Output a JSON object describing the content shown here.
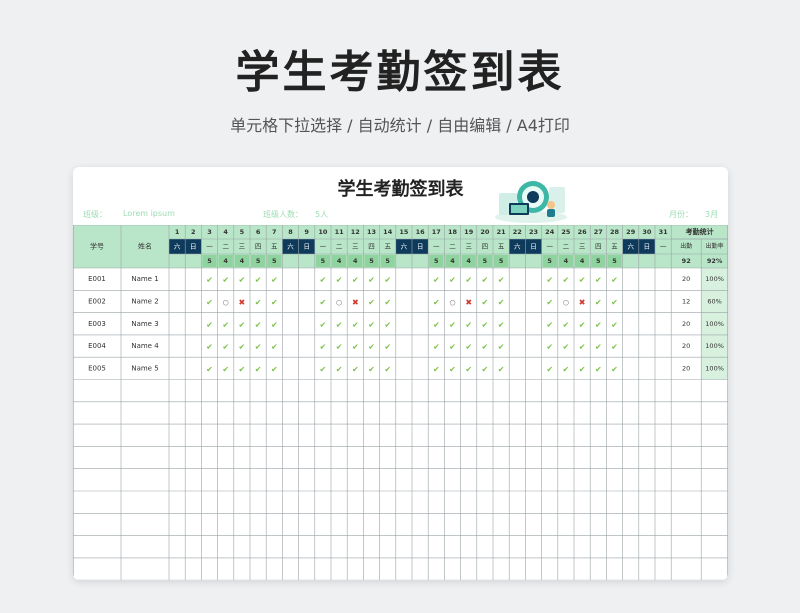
{
  "page": {
    "title": "学生考勤签到表",
    "subtitle": "单元格下拉选择 / 自动统计 / 自由编辑 / A4打印"
  },
  "sheet": {
    "title": "学生考勤签到表",
    "class_label": "班级：",
    "class_value": "Lorem ipsum",
    "count_label": "班级人数：",
    "count_value": "5人",
    "month_label": "月份：",
    "month_value": "3月"
  },
  "headers": {
    "id": "学号",
    "name": "姓名",
    "stats": "考勤统计",
    "present": "出勤",
    "rate": "出勤率"
  },
  "days": [
    "1",
    "2",
    "3",
    "4",
    "5",
    "6",
    "7",
    "8",
    "9",
    "10",
    "11",
    "12",
    "13",
    "14",
    "15",
    "16",
    "17",
    "18",
    "19",
    "20",
    "21",
    "22",
    "23",
    "24",
    "25",
    "26",
    "27",
    "28",
    "29",
    "30",
    "31"
  ],
  "weekdays": [
    "六",
    "日",
    "一",
    "二",
    "三",
    "四",
    "五",
    "六",
    "日",
    "一",
    "二",
    "三",
    "四",
    "五",
    "六",
    "日",
    "一",
    "二",
    "三",
    "四",
    "五",
    "六",
    "日",
    "一",
    "二",
    "三",
    "四",
    "五",
    "六",
    "日",
    "一"
  ],
  "daily_totals": [
    "",
    "",
    "5",
    "4",
    "4",
    "5",
    "5",
    "",
    "",
    "5",
    "4",
    "4",
    "5",
    "5",
    "",
    "",
    "5",
    "4",
    "4",
    "5",
    "5",
    "",
    "",
    "5",
    "4",
    "4",
    "5",
    "5",
    "",
    "",
    ""
  ],
  "summary": {
    "present_total": "92",
    "rate_total": "92%"
  },
  "marks": {
    "present": "✔",
    "leave": "○",
    "absent": "✖"
  },
  "students": [
    {
      "id": "E001",
      "name": "Name 1",
      "present": "20",
      "rate": "100%",
      "marks": [
        "",
        "",
        "p",
        "p",
        "p",
        "p",
        "p",
        "",
        "",
        "p",
        "p",
        "p",
        "p",
        "p",
        "",
        "",
        "p",
        "p",
        "p",
        "p",
        "p",
        "",
        "",
        "p",
        "p",
        "p",
        "p",
        "p",
        "",
        "",
        ""
      ]
    },
    {
      "id": "E002",
      "name": "Name 2",
      "present": "12",
      "rate": "60%",
      "marks": [
        "",
        "",
        "p",
        "o",
        "x",
        "p",
        "p",
        "",
        "",
        "p",
        "o",
        "x",
        "p",
        "p",
        "",
        "",
        "p",
        "o",
        "x",
        "p",
        "p",
        "",
        "",
        "p",
        "o",
        "x",
        "p",
        "p",
        "",
        "",
        ""
      ]
    },
    {
      "id": "E003",
      "name": "Name 3",
      "present": "20",
      "rate": "100%",
      "marks": [
        "",
        "",
        "p",
        "p",
        "p",
        "p",
        "p",
        "",
        "",
        "p",
        "p",
        "p",
        "p",
        "p",
        "",
        "",
        "p",
        "p",
        "p",
        "p",
        "p",
        "",
        "",
        "p",
        "p",
        "p",
        "p",
        "p",
        "",
        "",
        ""
      ]
    },
    {
      "id": "E004",
      "name": "Name 4",
      "present": "20",
      "rate": "100%",
      "marks": [
        "",
        "",
        "p",
        "p",
        "p",
        "p",
        "p",
        "",
        "",
        "p",
        "p",
        "p",
        "p",
        "p",
        "",
        "",
        "p",
        "p",
        "p",
        "p",
        "p",
        "",
        "",
        "p",
        "p",
        "p",
        "p",
        "p",
        "",
        "",
        ""
      ]
    },
    {
      "id": "E005",
      "name": "Name 5",
      "present": "20",
      "rate": "100%",
      "marks": [
        "",
        "",
        "p",
        "p",
        "p",
        "p",
        "p",
        "",
        "",
        "p",
        "p",
        "p",
        "p",
        "p",
        "",
        "",
        "p",
        "p",
        "p",
        "p",
        "p",
        "",
        "",
        "p",
        "p",
        "p",
        "p",
        "p",
        "",
        "",
        ""
      ]
    }
  ],
  "empty_rows": 9,
  "colors": {
    "header_green": "#b9e6c8",
    "weekend_navy": "#0e3a5c",
    "total_green": "#8fd39f",
    "check_green": "#7cc24a",
    "absent_red": "#d0382b",
    "grid_line": "#9aa3a8"
  }
}
